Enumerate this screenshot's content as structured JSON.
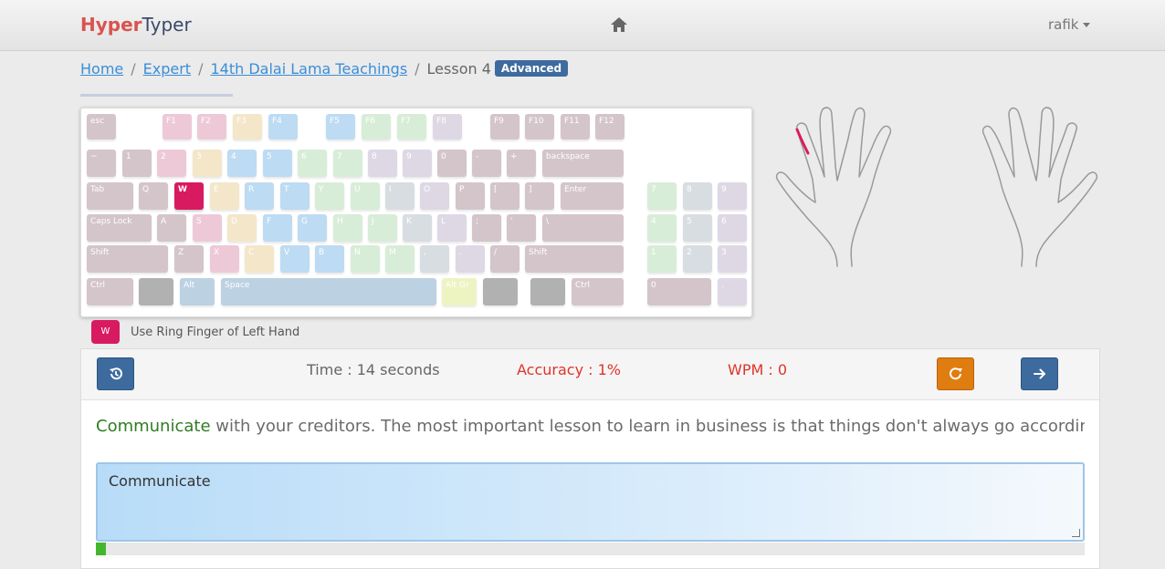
{
  "brand": {
    "part1": "Hyper",
    "part2": "Typer"
  },
  "nav": {
    "user": "rafik"
  },
  "breadcrumb": {
    "home": "Home",
    "expert": "Expert",
    "course": "14th Dalai Lama Teachings",
    "lesson": "Lesson 4",
    "badge": "Advanced"
  },
  "keyboard": {
    "active_key": "W",
    "rows": [
      [
        "esc",
        "F1",
        "F2",
        "F3",
        "F4",
        "F5",
        "F6",
        "F7",
        "F8",
        "F9",
        "F10",
        "F11",
        "F12"
      ],
      [
        "~",
        "1",
        "2",
        "3",
        "4",
        "5",
        "6",
        "7",
        "8",
        "9",
        "0",
        "-",
        "+",
        "backspace"
      ],
      [
        "Tab",
        "Q",
        "W",
        "E",
        "R",
        "T",
        "Y",
        "U",
        "I",
        "O",
        "P",
        "[",
        "]",
        "Enter"
      ],
      [
        "Caps Lock",
        "A",
        "S",
        "D",
        "F",
        "G",
        "H",
        "J",
        "K",
        "L",
        ";",
        "'",
        "\\"
      ],
      [
        "Shift",
        "Z",
        "X",
        "C",
        "V",
        "B",
        "N",
        "M",
        ",",
        ".",
        "/",
        "Shift"
      ],
      [
        "Ctrl",
        "",
        "Alt",
        "Space",
        "Alt Gr",
        "",
        "",
        "Ctrl"
      ]
    ],
    "numpad": [
      "7",
      "8",
      "9",
      "4",
      "5",
      "6",
      "1",
      "2",
      "3",
      "0",
      "."
    ]
  },
  "hint": {
    "key": "W",
    "text": "Use Ring Finger of Left Hand"
  },
  "stats": {
    "time": "Time : 14 seconds",
    "accuracy": "Accuracy : 1%",
    "wpm": "WPM : 0"
  },
  "lesson": {
    "typed": "Communicate",
    "current": "w",
    "remaining": "ith your creditors. The most important lesson to learn in business is that things don't always go according to plan."
  },
  "input": {
    "value": "Communicate"
  },
  "progress": {
    "fraction": 0.01
  },
  "colors": {
    "accent": "#3d6b9e",
    "active_key": "#d81b60",
    "warning": "#e07d10",
    "error": "#e0332a",
    "success": "#2f7d22"
  }
}
